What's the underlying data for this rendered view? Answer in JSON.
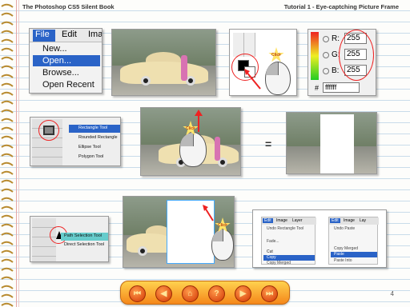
{
  "header": {
    "book_title": "The Photoshop CS5 Silent Book",
    "tutorial_title": "Tutorial 1 - Eye-captching Picture Frame"
  },
  "file_menu": {
    "bar": [
      "File",
      "Edit",
      "Ima"
    ],
    "items": [
      "New...",
      "Open...",
      "Browse...",
      "Open Recent"
    ]
  },
  "color_picker": {
    "r_label": "R:",
    "g_label": "G:",
    "b_label": "B:",
    "r": "255",
    "g": "255",
    "b": "255",
    "hex_label": "#",
    "hex": "ffffff"
  },
  "tool_flyout": {
    "items": [
      "Rectangle Tool",
      "Rounded Rectangle",
      "Ellipse Tool",
      "Polygon Tool"
    ]
  },
  "burst_text": "Click",
  "equals": "=",
  "path_flyout": {
    "items": [
      "Path Selection Tool",
      "Direct Selection Tool"
    ]
  },
  "edit_menu_1": {
    "bar": [
      "Edit",
      "Image",
      "Layer"
    ],
    "items": [
      "Undo Rectangle Tool",
      "Fade...",
      "Cut",
      "Copy",
      "Copy Merged"
    ]
  },
  "edit_menu_2": {
    "bar": [
      "Edit",
      "Image",
      "Lay"
    ],
    "items": [
      "Undo Paste",
      "Copy Merged",
      "Paste",
      "Paste Into"
    ]
  },
  "nav": {
    "buttons": [
      "⏮",
      "◀",
      "⌂",
      "?",
      "▶",
      "⏭"
    ]
  },
  "page_number": "4",
  "colors": {
    "accent_red": "#e22222",
    "menu_highlight": "#2a63c7",
    "nav_orange": "#f5871a"
  }
}
